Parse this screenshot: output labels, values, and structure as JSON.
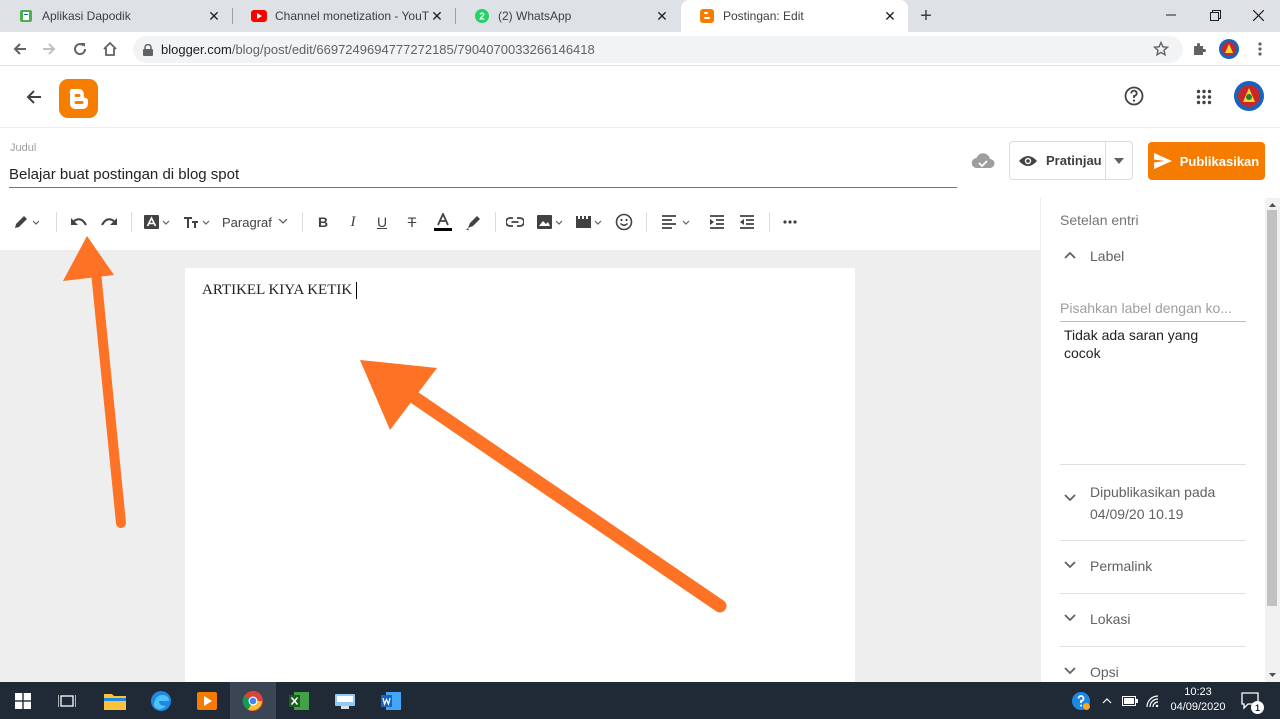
{
  "browser": {
    "tabs": [
      {
        "title": "Aplikasi Dapodik",
        "icon": "dapodik-icon",
        "active": false
      },
      {
        "title": "Channel monetization - YouTube",
        "icon": "youtube-icon",
        "active": false
      },
      {
        "title": "(2) WhatsApp",
        "icon": "whatsapp-icon",
        "badge": "2",
        "active": false
      },
      {
        "title": "Postingan: Edit",
        "icon": "blogger-icon",
        "active": true
      }
    ],
    "url_host": "blogger.com",
    "url_path": "/blog/post/edit/6697249694777272185/7904070033266146418"
  },
  "post": {
    "title_label": "Judul",
    "title_value": "Belajar buat postingan di blog spot",
    "preview_label": "Pratinjau",
    "publish_label": "Publikasikan"
  },
  "toolbar": {
    "paragraph_label": "Paragraf"
  },
  "editor": {
    "body_text": "ARTIKEL KIYA KETIK"
  },
  "sidebar": {
    "heading": "Setelan entri",
    "label_section": "Label",
    "label_placeholder": "Pisahkan label dengan ko...",
    "no_suggestion": "Tidak ada saran yang cocok",
    "published_title": "Dipublikasikan pada",
    "published_date": "04/09/20 10.19",
    "permalink": "Permalink",
    "lokasi": "Lokasi",
    "opsi": "Opsi"
  },
  "taskbar": {
    "time": "10:23",
    "date": "04/09/2020",
    "notification_count": "1"
  },
  "colors": {
    "accent": "#f57c00",
    "annotation_arrow": "#fd7225",
    "taskbar": "#1f2a36"
  }
}
